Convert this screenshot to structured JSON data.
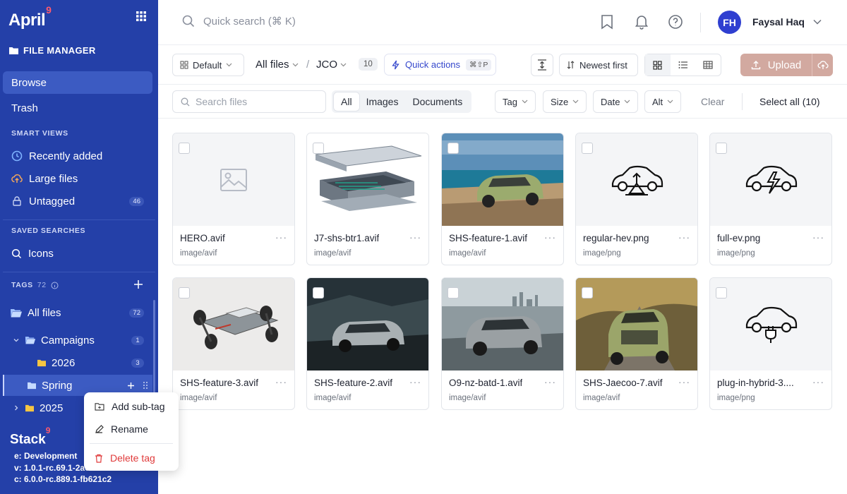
{
  "app": {
    "name": "April",
    "name_badge": "9"
  },
  "sidebar": {
    "section_title": "FILE MANAGER",
    "nav": [
      {
        "label": "Browse",
        "active": true
      },
      {
        "label": "Trash"
      }
    ],
    "smart_views_label": "SMART VIEWS",
    "smart_views": [
      {
        "label": "Recently added",
        "icon": "clock-icon"
      },
      {
        "label": "Large files",
        "icon": "cloud-upload-icon"
      },
      {
        "label": "Untagged",
        "icon": "lock-icon",
        "count": "46"
      }
    ],
    "saved_searches_label": "SAVED SEARCHES",
    "saved_searches": [
      {
        "label": "Icons",
        "icon": "search-icon"
      }
    ],
    "tags_label": "TAGS",
    "tags_count": "72",
    "tags": [
      {
        "label": "All files",
        "count": "72"
      },
      {
        "label": "Campaigns",
        "count": "1"
      },
      {
        "label": "2026",
        "count": "3"
      },
      {
        "label": "Spring"
      },
      {
        "label": "2025"
      }
    ],
    "footer": {
      "stack_name": "Stack",
      "stack_badge": "9",
      "env": "e: Development",
      "version_v": "v: 1.0.1-rc.69.1-2ae",
      "version_c": "c: 6.0.0-rc.889.1-fb621c2"
    }
  },
  "context_menu": {
    "add_sub_tag": "Add sub-tag",
    "rename": "Rename",
    "delete_tag": "Delete tag"
  },
  "topbar": {
    "search_placeholder": "Quick search (⌘ K)",
    "user_initials": "FH",
    "user_name": "Faysal Haq"
  },
  "toolbar": {
    "view_preset": "Default",
    "breadcrumb_root": "All files",
    "breadcrumb_sep": "/",
    "breadcrumb_current": "JCO",
    "item_count": "10",
    "quick_actions": "Quick actions",
    "quick_actions_kbd": "⌘⇧P",
    "sort": "Newest first",
    "upload": "Upload"
  },
  "filters": {
    "search_placeholder": "Search files",
    "types": [
      {
        "label": "All",
        "active": true
      },
      {
        "label": "Images"
      },
      {
        "label": "Documents"
      }
    ],
    "tag": "Tag",
    "size": "Size",
    "date": "Date",
    "alt": "Alt",
    "clear": "Clear",
    "select_all": "Select all (10)"
  },
  "files": [
    {
      "name": "HERO.avif",
      "type": "image/avif",
      "thumb": "placeholder"
    },
    {
      "name": "J7-shs-btr1.avif",
      "type": "image/avif",
      "thumb": "battery"
    },
    {
      "name": "SHS-feature-1.avif",
      "type": "image/avif",
      "thumb": "car-coast"
    },
    {
      "name": "regular-hev.png",
      "type": "image/png",
      "thumb": "icon-hev"
    },
    {
      "name": "full-ev.png",
      "type": "image/png",
      "thumb": "icon-ev"
    },
    {
      "name": "SHS-feature-3.avif",
      "type": "image/avif",
      "thumb": "chassis"
    },
    {
      "name": "SHS-feature-2.avif",
      "type": "image/avif",
      "thumb": "car-dark"
    },
    {
      "name": "O9-nz-batd-1.avif",
      "type": "image/avif",
      "thumb": "car-city"
    },
    {
      "name": "SHS-Jaecoo-7.avif",
      "type": "image/avif",
      "thumb": "car-green"
    },
    {
      "name": "plug-in-hybrid-3....",
      "type": "image/png",
      "thumb": "icon-phev"
    }
  ],
  "colors": {
    "sidebar": "#2440a8",
    "accent": "#3447cc",
    "upload": "#d2a9a0",
    "danger": "#e03a3a"
  }
}
